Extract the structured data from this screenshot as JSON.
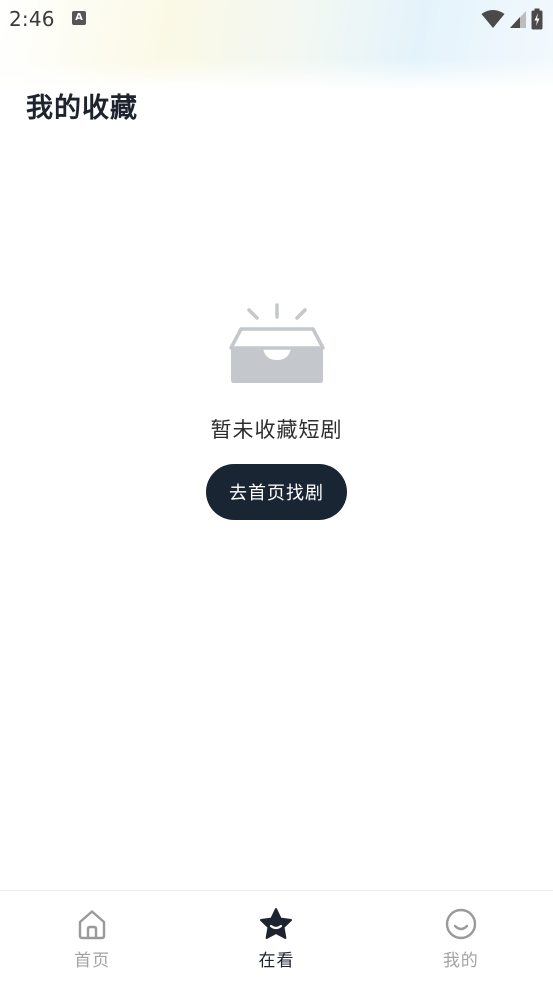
{
  "status_bar": {
    "time": "2:46",
    "notification_icon": "A"
  },
  "header": {
    "title": "我的收藏"
  },
  "empty_state": {
    "icon": "empty-inbox-icon",
    "message": "暂未收藏短剧",
    "button_label": "去首页找剧"
  },
  "bottom_nav": {
    "items": [
      {
        "label": "首页",
        "icon": "home-icon",
        "active": false
      },
      {
        "label": "在看",
        "icon": "star-icon",
        "active": true
      },
      {
        "label": "我的",
        "icon": "smiley-icon",
        "active": false
      }
    ]
  },
  "colors": {
    "accent": "#1a2533",
    "inactive_text": "#a3a3a3",
    "icon_gray": "#c4c7cc"
  }
}
